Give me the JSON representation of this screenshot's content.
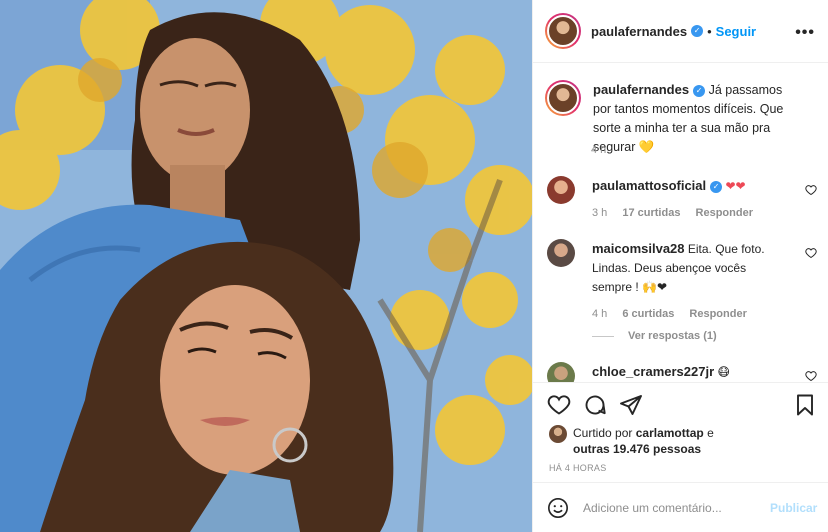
{
  "post": {
    "author": "paulafernandes",
    "separator": "•",
    "follow_label": "Seguir",
    "more_label": "•••"
  },
  "caption": {
    "username": "paulafernandes",
    "text": "Já passamos por tantos momentos difíceis. Que sorte a minha ter a sua mão pra segurar 💛",
    "time": "4 h"
  },
  "comments": [
    {
      "username": "paulamattosoficial",
      "text": "❤❤",
      "time": "3 h",
      "likes": "17 curtidas",
      "reply": "Responder",
      "avatar_color": "#8a3a2e"
    },
    {
      "username": "maicomsilva28",
      "text": "Eita. Que foto. Lindas. Deus abençoe vocês sempre ! 🙌❤",
      "time": "4 h",
      "likes": "6 curtidas",
      "reply": "Responder",
      "avatar_color": "#5a4a44"
    },
    {
      "username": "chloe_cramers227jr",
      "text": "😷allowance",
      "avatar_color": "#6b7a4a"
    }
  ],
  "view_replies": "Ver respostas (1)",
  "liked_by": {
    "prefix": "Curtido por",
    "user": "carlamottap",
    "conj": "e",
    "others": "outras 19.476 pessoas"
  },
  "time_ago": "HÁ 4 HORAS",
  "add_comment": {
    "placeholder": "Adicione um comentário...",
    "publish": "Publicar"
  },
  "colors": {
    "accent": "#0095f6",
    "verified": "#3897f0",
    "heart_red": "#ed4956",
    "muted": "#8e8e8e"
  },
  "icons": [
    "heart-icon",
    "comment-icon",
    "share-icon",
    "bookmark-icon",
    "emoji-icon",
    "verified-icon",
    "more-options-icon"
  ]
}
